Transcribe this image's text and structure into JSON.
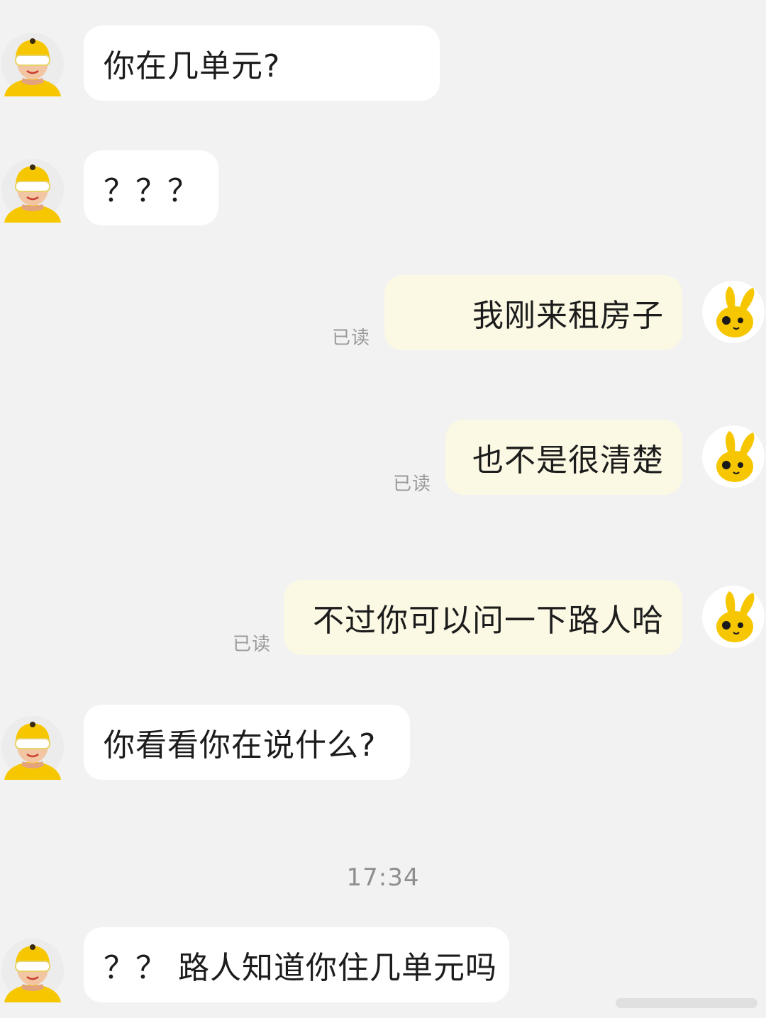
{
  "messages": [
    {
      "side": "in",
      "text": "你在几单元?"
    },
    {
      "side": "in",
      "text": "？？？"
    },
    {
      "side": "out",
      "text": "我刚来租房子",
      "status": "已读"
    },
    {
      "side": "out",
      "text": "也不是很清楚",
      "status": "已读"
    },
    {
      "side": "out",
      "text": "不过你可以问一下路人哈",
      "status": "已读"
    },
    {
      "side": "in",
      "text": "你看看你在说什么?"
    },
    {
      "side": "in",
      "text": "？？ 路人知道你住几单元吗"
    }
  ],
  "timestamp": "17:34",
  "avatars": {
    "other": "courier-avatar-icon",
    "self": "yellow-bunny-avatar-icon"
  },
  "colors": {
    "background": "#f2f2f2",
    "incoming_bubble": "#ffffff",
    "outgoing_bubble": "#fbf8e4",
    "avatar_yellow": "#f6c700"
  }
}
